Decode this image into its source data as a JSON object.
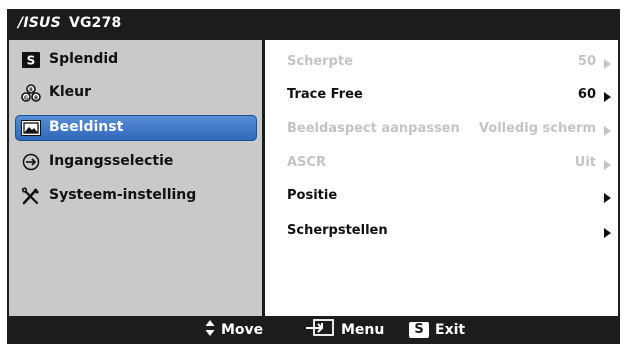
{
  "header": {
    "logo": "/ISUS",
    "model": "VG278"
  },
  "menu": [
    {
      "label": "Splendid",
      "icon": "splendid-s-icon",
      "selected": false
    },
    {
      "label": "Kleur",
      "icon": "color-palette-icon",
      "selected": false
    },
    {
      "label": "Beeldinst",
      "icon": "picture-icon",
      "selected": true
    },
    {
      "label": "Ingangsselectie",
      "icon": "input-arrow-icon",
      "selected": false
    },
    {
      "label": "Systeem-instelling",
      "icon": "tools-icon",
      "selected": false
    }
  ],
  "settings": [
    {
      "label": "Scherpte",
      "value": "50",
      "enabled": false
    },
    {
      "label": "Trace Free",
      "value": "60",
      "enabled": true
    },
    {
      "label": "Beeldaspect aanpassen",
      "value": "Volledig scherm",
      "enabled": false
    },
    {
      "label": "ASCR",
      "value": "Uit",
      "enabled": false
    },
    {
      "label": "Positie",
      "value": "",
      "enabled": true
    },
    {
      "label": "Scherpstellen",
      "value": "",
      "enabled": true
    }
  ],
  "footer": {
    "move": "Move",
    "menu": "Menu",
    "exit_key": "S",
    "exit": "Exit"
  },
  "colors": {
    "osd_dark": "#1c1c1c",
    "left_panel": "#c9c9c9",
    "selected_blue": "#3a75c4",
    "disabled_text": "#c4c4c4"
  }
}
